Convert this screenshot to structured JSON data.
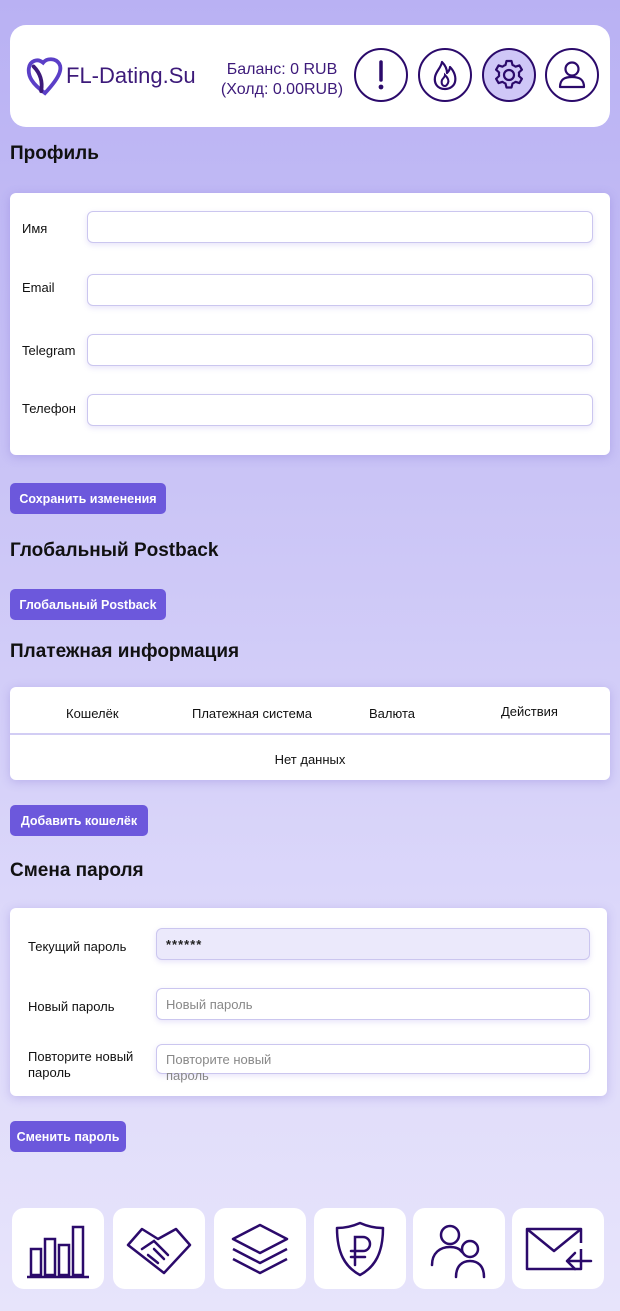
{
  "header": {
    "logo_text": "FL-Dating.Su",
    "balance": "Баланс: 0 RUB",
    "hold": "(Холд: 0.00RUB)",
    "icons": [
      "alert-icon",
      "fire-icon",
      "settings-icon",
      "user-icon"
    ]
  },
  "profile": {
    "title": "Профиль",
    "fields": [
      {
        "label": "Имя",
        "value": ""
      },
      {
        "label": "Email",
        "value": ""
      },
      {
        "label": "Telegram",
        "value": ""
      },
      {
        "label": "Телефон",
        "value": ""
      }
    ],
    "save_button": "Сохранить изменения"
  },
  "postback": {
    "title": "Глобальный Postback",
    "button": "Глобальный Postback"
  },
  "payment": {
    "title": "Платежная информация",
    "columns": [
      "Кошелёк",
      "Платежная система",
      "Валюта",
      "Действия"
    ],
    "empty": "Нет данных",
    "add_button": "Добавить кошелёк"
  },
  "password": {
    "title": "Смена пароля",
    "current_label": "Текущий пароль",
    "current_value": "******",
    "new_label": "Новый пароль",
    "new_placeholder": "Новый пароль",
    "repeat_label": "Повторите новый пароль",
    "repeat_placeholder": "Повторите новый пароль",
    "button": "Сменить пароль"
  },
  "bottom_nav": [
    "stats-icon",
    "handshake-icon",
    "layers-icon",
    "ruble-shield-icon",
    "users-icon",
    "mail-icon"
  ],
  "colors": {
    "accent": "#6c58dc",
    "brand_dark": "#2b0a6b"
  }
}
